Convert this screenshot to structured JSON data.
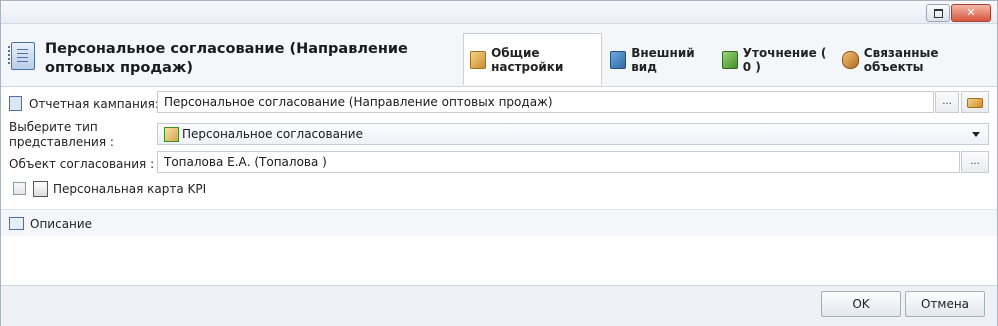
{
  "header": {
    "title": "Персональное согласование (Направление оптовых продаж)"
  },
  "tabs": [
    {
      "label": "Общие настройки",
      "active": true
    },
    {
      "label": "Внешний вид"
    },
    {
      "label": "Уточнение ( 0 )"
    },
    {
      "label": "Связанные объекты"
    }
  ],
  "form": {
    "campaign_label": "Отчетная кампания:",
    "campaign_value": "Персональное согласование (Направление оптовых продаж)",
    "campaign_btn": "...",
    "view_type_label": "Выберите тип представления :",
    "view_type_value": "Персональное согласование",
    "object_label": "Объект согласования :",
    "object_value": "Топалова Е.А. (Топалова )",
    "object_btn": "...",
    "kpi_label": "Персональная карта KPI",
    "kpi_checked": false
  },
  "description": {
    "label": "Описание"
  },
  "footer": {
    "ok_label": "OK",
    "cancel_label": "Отмена"
  }
}
